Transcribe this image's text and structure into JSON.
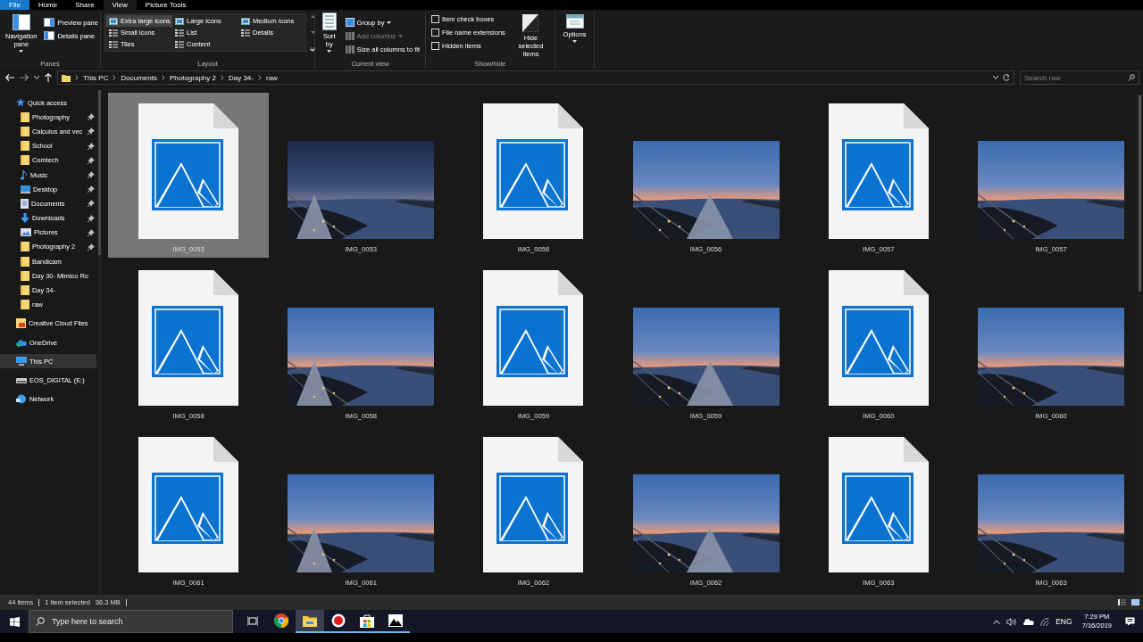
{
  "ribbon": {
    "tabs": [
      {
        "label": "File",
        "kind": "file",
        "selected": false
      },
      {
        "label": "Home",
        "kind": "tab",
        "selected": false
      },
      {
        "label": "Share",
        "kind": "tab",
        "selected": false
      },
      {
        "label": "View",
        "kind": "tab",
        "selected": true
      },
      {
        "label": "Picture Tools",
        "kind": "context",
        "selected": false
      }
    ],
    "panes": {
      "label": "Panes",
      "items": [
        {
          "label": "Navigation pane",
          "kind": "big"
        },
        {
          "label": "Preview pane",
          "kind": "small"
        },
        {
          "label": "Details pane",
          "kind": "small"
        }
      ]
    },
    "layout": {
      "label": "Layout",
      "options": [
        {
          "label": "Extra large icons",
          "selected": true
        },
        {
          "label": "Small icons",
          "selected": false
        },
        {
          "label": "Tiles",
          "selected": false
        },
        {
          "label": "Large icons",
          "selected": false
        },
        {
          "label": "List",
          "selected": false
        },
        {
          "label": "Content",
          "selected": false
        },
        {
          "label": "Medium icons",
          "selected": false
        },
        {
          "label": "Details",
          "selected": false
        }
      ]
    },
    "current_view": {
      "label": "Current view",
      "items": [
        {
          "label": "Sort by",
          "kind": "big",
          "disabled": false
        },
        {
          "label": "Group by",
          "kind": "menu",
          "disabled": false
        },
        {
          "label": "Add columns",
          "kind": "menu",
          "disabled": true
        },
        {
          "label": "Size all columns to fit",
          "kind": "small",
          "disabled": false
        }
      ]
    },
    "show_hide": {
      "label": "Show/hide",
      "checkboxes": [
        {
          "label": "Item check boxes",
          "checked": false
        },
        {
          "label": "File name extensions",
          "checked": false
        },
        {
          "label": "Hidden items",
          "checked": false
        }
      ],
      "button": "Hide selected items"
    },
    "options": {
      "label": "Options"
    }
  },
  "address": {
    "crumbs": [
      "This PC",
      "Documents",
      "Photography 2",
      "Day 34-",
      "raw"
    ],
    "search_placeholder": "Search raw"
  },
  "nav": [
    {
      "label": "Quick access",
      "kind": "star",
      "pinned": false,
      "selected": false,
      "children": [
        {
          "label": "Photography",
          "kind": "folder",
          "pinned": true,
          "selected": false
        },
        {
          "label": "Calculus and vec",
          "kind": "folder",
          "pinned": true,
          "selected": false
        },
        {
          "label": "School",
          "kind": "folder",
          "pinned": true,
          "selected": false
        },
        {
          "label": "Comtech",
          "kind": "folder",
          "pinned": true,
          "selected": false
        },
        {
          "label": "Music",
          "kind": "music",
          "pinned": true,
          "selected": false
        },
        {
          "label": "Desktop",
          "kind": "desktop",
          "pinned": true,
          "selected": false
        },
        {
          "label": "Documents",
          "kind": "documents",
          "pinned": true,
          "selected": false
        },
        {
          "label": "Downloads",
          "kind": "downloads",
          "pinned": true,
          "selected": false
        },
        {
          "label": "Pictures",
          "kind": "pictures",
          "pinned": true,
          "selected": false
        },
        {
          "label": "Photography 2",
          "kind": "folder",
          "pinned": true,
          "selected": false
        },
        {
          "label": "Bandicam",
          "kind": "folder",
          "pinned": false,
          "selected": false
        },
        {
          "label": "Day 30- Mimico Ro",
          "kind": "folder",
          "pinned": false,
          "selected": false
        },
        {
          "label": "Day 34-",
          "kind": "folder",
          "pinned": false,
          "selected": false
        },
        {
          "label": "raw",
          "kind": "folder",
          "pinned": false,
          "selected": false
        }
      ]
    },
    {
      "label": "Creative Cloud Files",
      "kind": "cloudfiles",
      "pinned": false,
      "selected": false
    },
    {
      "label": "OneDrive",
      "kind": "onedrive",
      "pinned": false,
      "selected": false
    },
    {
      "label": "This PC",
      "kind": "pc",
      "pinned": false,
      "selected": true
    },
    {
      "label": "EOS_DIGITAL (E:)",
      "kind": "drive",
      "pinned": false,
      "selected": false
    },
    {
      "label": "Network",
      "kind": "network",
      "pinned": false,
      "selected": false
    }
  ],
  "files": [
    {
      "name": "IMG_0053",
      "kind": "file",
      "selected": true
    },
    {
      "name": "IMG_0053",
      "kind": "picture",
      "selected": false
    },
    {
      "name": "IMG_0056",
      "kind": "file",
      "selected": false
    },
    {
      "name": "IMG_0056",
      "kind": "picture",
      "selected": false
    },
    {
      "name": "IMG_0057",
      "kind": "file",
      "selected": false
    },
    {
      "name": "IMG_0057",
      "kind": "picture",
      "selected": false
    },
    {
      "name": "IMG_0058",
      "kind": "file",
      "selected": false
    },
    {
      "name": "IMG_0058",
      "kind": "picture",
      "selected": false
    },
    {
      "name": "IMG_0059",
      "kind": "file",
      "selected": false
    },
    {
      "name": "IMG_0059",
      "kind": "picture",
      "selected": false
    },
    {
      "name": "IMG_0060",
      "kind": "file",
      "selected": false
    },
    {
      "name": "IMG_0060",
      "kind": "picture",
      "selected": false
    },
    {
      "name": "IMG_0061",
      "kind": "file",
      "selected": false
    },
    {
      "name": "IMG_0061",
      "kind": "picture",
      "selected": false
    },
    {
      "name": "IMG_0062",
      "kind": "file",
      "selected": false
    },
    {
      "name": "IMG_0062",
      "kind": "picture",
      "selected": false
    },
    {
      "name": "IMG_0063",
      "kind": "file",
      "selected": false
    },
    {
      "name": "IMG_0063",
      "kind": "picture",
      "selected": false
    }
  ],
  "status": {
    "count": "44 items",
    "selection": "1 item selected",
    "size": "36.3 MB"
  },
  "taskbar": {
    "search_placeholder": "Type here to search",
    "apps": [
      {
        "kind": "taskview",
        "running": false,
        "active": false
      },
      {
        "kind": "chrome",
        "running": false,
        "active": false
      },
      {
        "kind": "explorer",
        "running": true,
        "active": true
      },
      {
        "kind": "recorder",
        "running": true,
        "active": false
      },
      {
        "kind": "store",
        "running": true,
        "active": false
      },
      {
        "kind": "photos",
        "running": true,
        "active": false
      }
    ],
    "tray": {
      "language": "ENG",
      "time": "7:29 PM",
      "date": "7/16/2019"
    }
  }
}
